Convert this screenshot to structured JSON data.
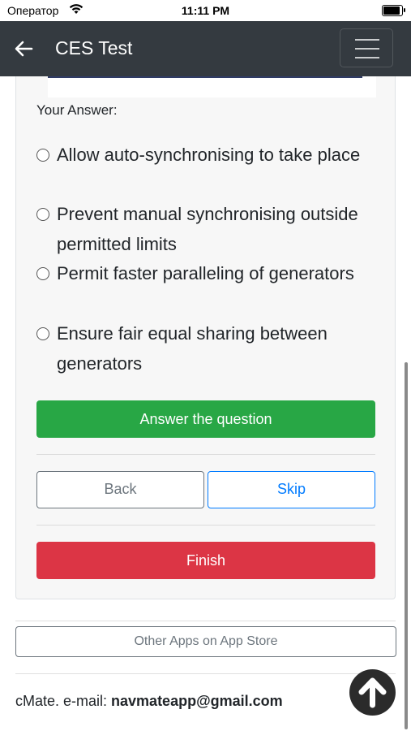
{
  "status_bar": {
    "carrier": "Оператор",
    "time": "11:11 PM"
  },
  "header": {
    "title": "CES Test",
    "back_icon": "arrow-left-icon",
    "menu_icon": "hamburger-menu-icon",
    "background": "#343a40"
  },
  "question": {
    "answer_label": "Your Answer:",
    "options": [
      {
        "label": "Allow auto-synchronising to take place",
        "selected": false
      },
      {
        "label": "Prevent manual synchronising outside permitted limits",
        "selected": false
      },
      {
        "label": "Permit faster paralleling of generators",
        "selected": false
      },
      {
        "label": "Ensure fair equal sharing between generators",
        "selected": false
      }
    ]
  },
  "buttons": {
    "answer": "Answer the question",
    "back": "Back",
    "skip": "Skip",
    "finish": "Finish"
  },
  "footer": {
    "other_apps": "Other Apps on App Store",
    "contact_prefix": "cMate. e-mail: ",
    "email": "navmateapp@gmail.com",
    "scroll_top_icon": "arrow-up-circle-icon"
  },
  "colors": {
    "success": "#28a745",
    "danger": "#dc3545",
    "primary": "#007bff",
    "secondary": "#6c757d"
  }
}
